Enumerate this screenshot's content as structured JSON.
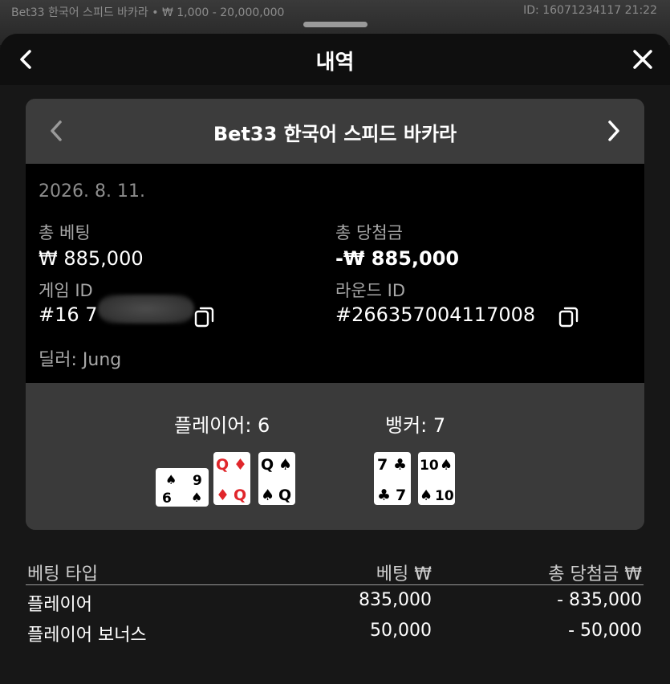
{
  "status": {
    "left": "Bet33 한국어 스피드 바카라 • ₩ 1,000 - 20,000,000",
    "right": "ID: 16071234117 21:22"
  },
  "header": {
    "title": "내역"
  },
  "game": {
    "title": "Bet33 한국어 스피드 바카라",
    "date": "2026. 8. 11.",
    "total_bet_label": "총 베팅",
    "total_bet_value": "₩ 885,000",
    "total_win_label": "총 당첨금",
    "total_win_value": "-₩ 885,000",
    "game_id_label": "게임 ID",
    "game_id_value": "#16       7",
    "round_id_label": "라운드 ID",
    "round_id_value": "#266357004117008",
    "dealer": "딜러: Jung"
  },
  "result": {
    "player_label": "플레이어: 6",
    "banker_label": "뱅커: 7",
    "player_cards": [
      {
        "rank": "6",
        "suit": "spade",
        "orientation": "sideways"
      },
      {
        "rank": "Q",
        "suit": "diamond",
        "orientation": "upright"
      },
      {
        "rank": "Q",
        "suit": "spade",
        "orientation": "upright"
      }
    ],
    "banker_cards": [
      {
        "rank": "7",
        "suit": "club",
        "orientation": "upright"
      },
      {
        "rank": "10",
        "suit": "spade",
        "orientation": "upright"
      }
    ]
  },
  "bets": {
    "headers": [
      "베팅 타입",
      "베팅 ₩",
      "총 당첨금 ₩"
    ],
    "rows": [
      [
        "플레이어",
        "835,000",
        "- 835,000"
      ],
      [
        "플레이어 보너스",
        "50,000",
        "- 50,000"
      ]
    ]
  },
  "colors": {
    "red_suit": "#e0262b",
    "black_suit": "#000000",
    "sheet_bg": "#171717"
  }
}
